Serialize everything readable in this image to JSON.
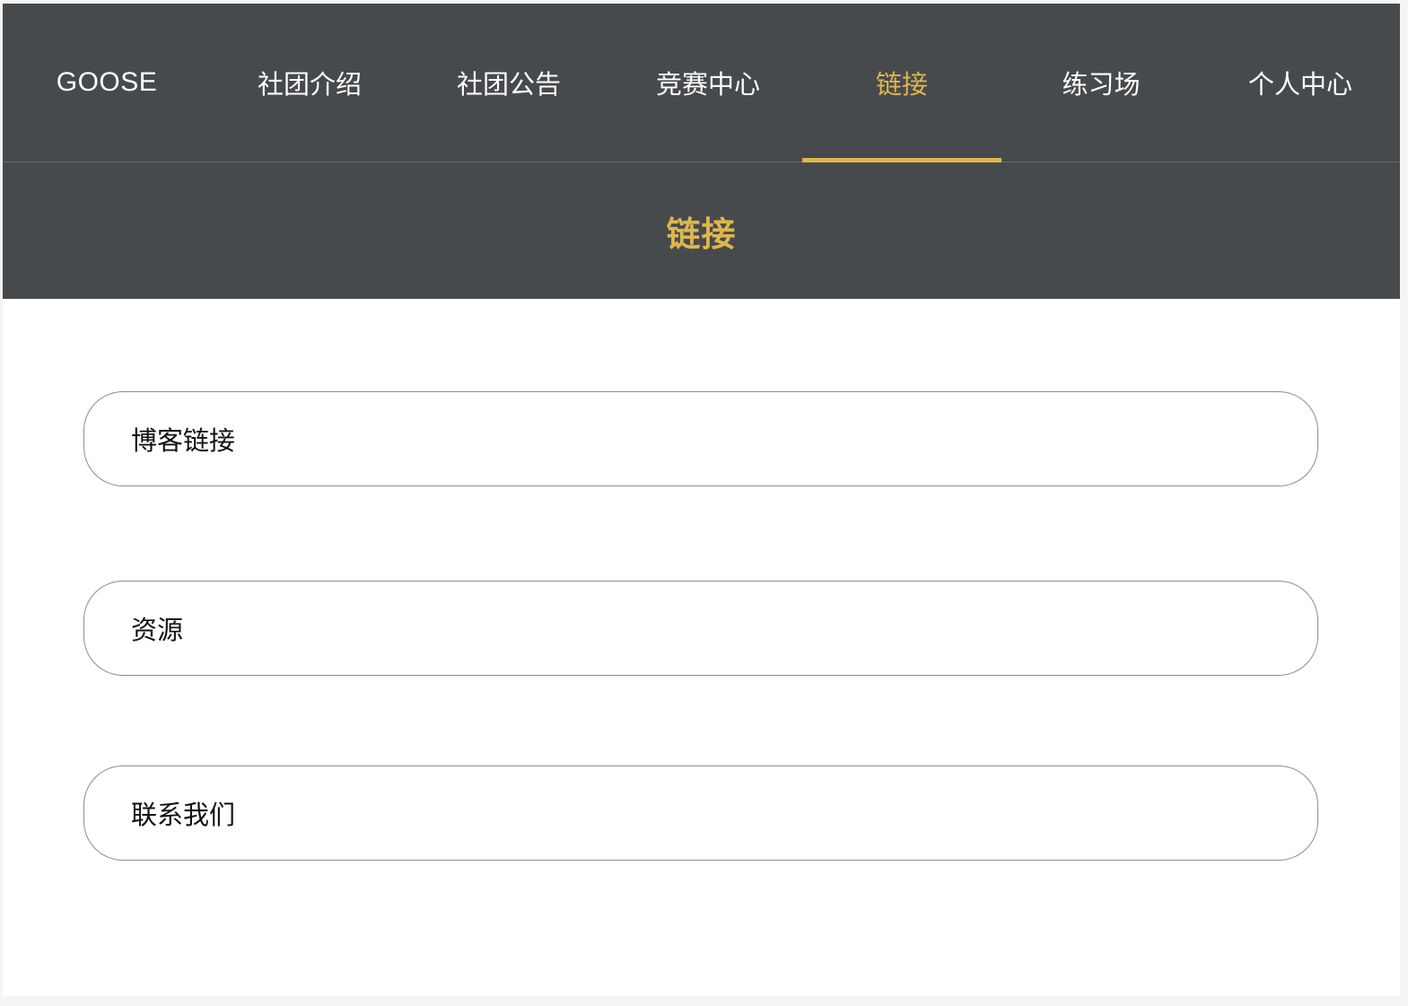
{
  "nav": {
    "brand": "GOOSE",
    "items": [
      {
        "label": "社团介绍"
      },
      {
        "label": "社团公告"
      },
      {
        "label": "竞赛中心"
      },
      {
        "label": "链接",
        "active": true
      },
      {
        "label": "练习场"
      },
      {
        "label": "个人中心"
      }
    ]
  },
  "banner": {
    "title": "链接"
  },
  "links": [
    {
      "label": "博客链接"
    },
    {
      "label": "资源"
    },
    {
      "label": "联系我们"
    }
  ],
  "colors": {
    "nav_background": "#474a4d",
    "accent": "#dcb64e",
    "card_border": "#8c8c8c"
  }
}
